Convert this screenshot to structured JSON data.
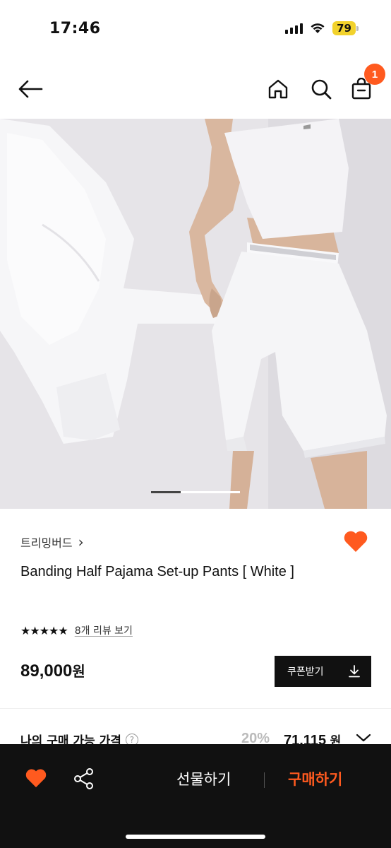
{
  "status_bar": {
    "time": "17:46",
    "battery": "79",
    "battery_color": "#f2d22c",
    "icons": [
      "signal-icon",
      "wifi-icon",
      "battery-icon"
    ]
  },
  "nav": {
    "back_icon": "arrow-left-icon",
    "home_icon": "home-icon",
    "search_icon": "search-icon",
    "bag_icon": "shopping-bag-icon",
    "bag_badge": "1",
    "badge_color": "#ff5a1f"
  },
  "carousel": {
    "active_index": 0,
    "total": 3
  },
  "product": {
    "brand": "트리밍버드",
    "brand_chevron": "›",
    "title": "Banding Half Pajama Set-up Pants [ White ]",
    "rating_stars": "★★★★★",
    "rating_value": 5,
    "review_link": "8개 리뷰 보기",
    "price": "89,000",
    "price_unit": "원",
    "coupon_label": "쿠폰받기",
    "wishlisted": true,
    "heart_color": "#ff5a1f"
  },
  "purchase": {
    "label": "나의 구매 가능 가격",
    "help": "?",
    "discount_rate": "20%",
    "discount_price": "71,115",
    "price_unit": "원"
  },
  "bottom_bar": {
    "gift_label": "선물하기",
    "buy_label": "구매하기",
    "buy_color": "#ff5a1f",
    "icons": [
      "heart-icon",
      "share-icon"
    ]
  }
}
